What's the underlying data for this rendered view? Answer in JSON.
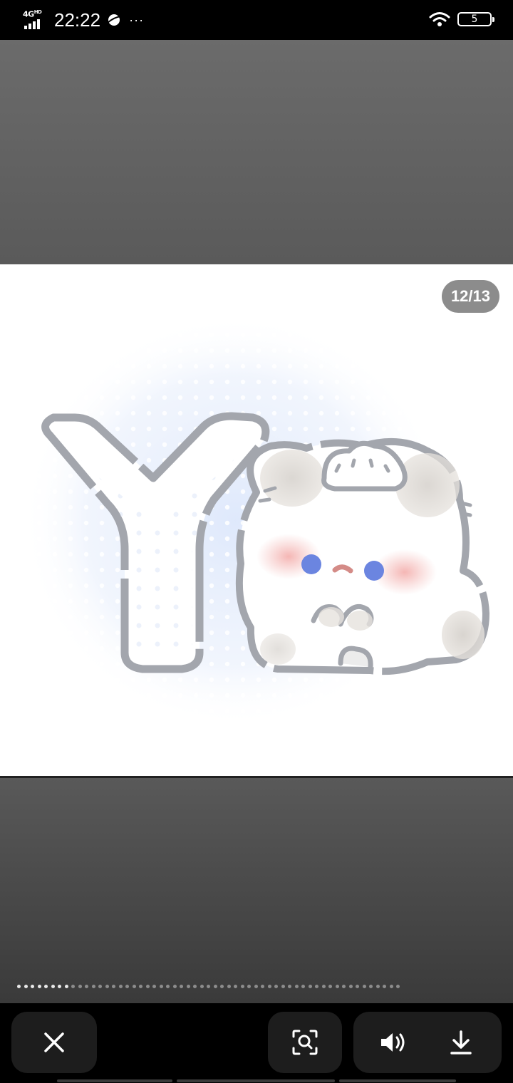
{
  "status_bar": {
    "network": "4G",
    "network_sup": "HD",
    "time": "22:22",
    "overflow": "···",
    "battery": "5",
    "icons": [
      "signal-icon",
      "planet-app-icon",
      "wifi-icon",
      "battery-icon"
    ]
  },
  "viewer": {
    "counter": "12/13",
    "current_index": 12,
    "total": 13,
    "image": {
      "glyph": "Y",
      "description_tag": "sticker-letter-y-with-bunny"
    }
  },
  "page_indicator": {
    "active_dots": 8,
    "total_dots": 57
  },
  "toolbar": {
    "close_icon": "close-icon",
    "lens_icon": "image-search-icon",
    "volume_icon": "volume-icon",
    "download_icon": "download-icon"
  },
  "colors": {
    "background": "#000000",
    "button_bg": "#1d1d1d",
    "counter_bg": "#787878",
    "outline_gray": "#a3a6ad",
    "eye_blue": "#6b85e0",
    "blush": "#f3b7b5"
  }
}
